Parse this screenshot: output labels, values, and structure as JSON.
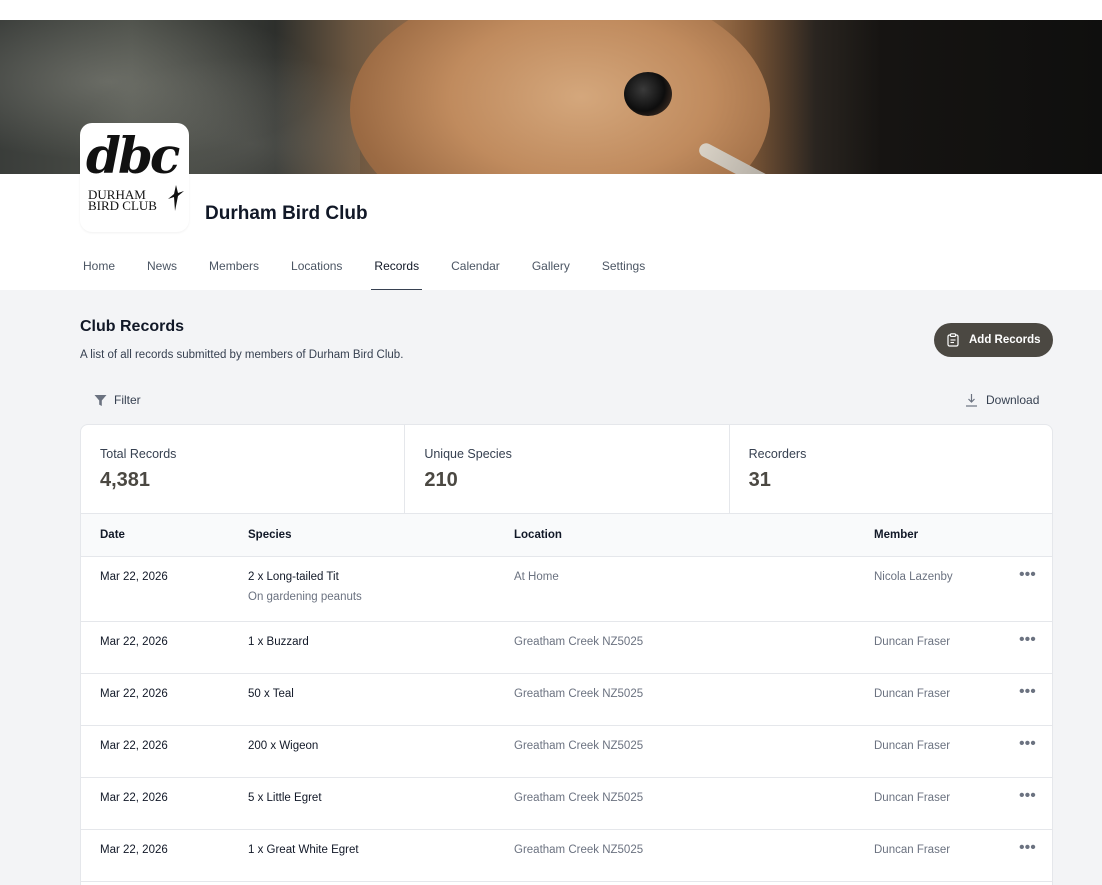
{
  "club": {
    "name": "Durham Bird Club",
    "logo_mark": "dbc",
    "logo_line1": "DURHAM",
    "logo_line2": "BIRD CLUB"
  },
  "nav": {
    "tabs": [
      {
        "label": "Home"
      },
      {
        "label": "News"
      },
      {
        "label": "Members"
      },
      {
        "label": "Locations"
      },
      {
        "label": "Records",
        "active": true
      },
      {
        "label": "Calendar"
      },
      {
        "label": "Gallery"
      },
      {
        "label": "Settings"
      }
    ]
  },
  "section": {
    "title": "Club Records",
    "description": "A list of all records submitted by members of Durham Bird Club.",
    "add_label": "Add Records"
  },
  "toolbar": {
    "filter_label": "Filter",
    "download_label": "Download"
  },
  "stats": [
    {
      "label": "Total Records",
      "value": "4,381"
    },
    {
      "label": "Unique Species",
      "value": "210"
    },
    {
      "label": "Recorders",
      "value": "31"
    }
  ],
  "table": {
    "headers": {
      "date": "Date",
      "species": "Species",
      "location": "Location",
      "member": "Member"
    },
    "more_glyph": "•••",
    "rows": [
      {
        "date": "Mar 22, 2026",
        "species": "2 x Long-tailed Tit",
        "note": "On gardening peanuts",
        "location": "At Home",
        "member": "Nicola Lazenby"
      },
      {
        "date": "Mar 22, 2026",
        "species": "1 x Buzzard",
        "location": "Greatham Creek NZ5025",
        "member": "Duncan Fraser"
      },
      {
        "date": "Mar 22, 2026",
        "species": "50 x Teal",
        "location": "Greatham Creek NZ5025",
        "member": "Duncan Fraser"
      },
      {
        "date": "Mar 22, 2026",
        "species": "200 x Wigeon",
        "location": "Greatham Creek NZ5025",
        "member": "Duncan Fraser"
      },
      {
        "date": "Mar 22, 2026",
        "species": "5 x Little Egret",
        "location": "Greatham Creek NZ5025",
        "member": "Duncan Fraser"
      },
      {
        "date": "Mar 22, 2026",
        "species": "1 x Great White Egret",
        "location": "Greatham Creek NZ5025",
        "member": "Duncan Fraser"
      }
    ]
  },
  "colors": {
    "accent_button": "#4b4842",
    "page_background": "#f3f4f6"
  },
  "icons": {
    "add": "clipboard-icon",
    "filter": "funnel-icon",
    "download": "download-icon",
    "row_menu": "ellipsis-icon"
  }
}
